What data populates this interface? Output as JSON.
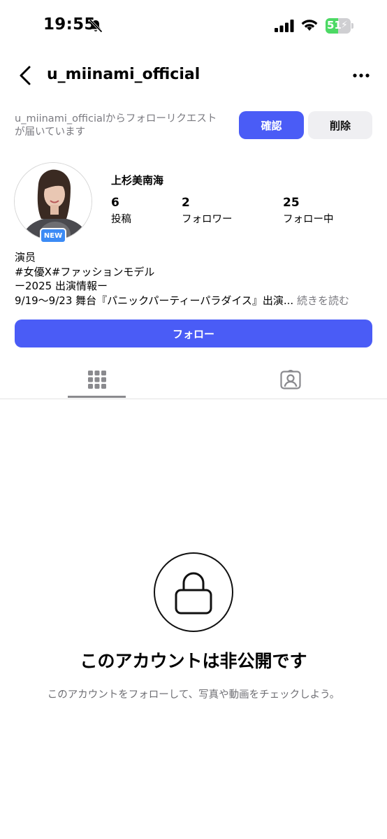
{
  "status_bar": {
    "time": "19:55",
    "battery_level": "51",
    "icons": [
      "bell-slash-icon",
      "signal-icon",
      "wifi-icon",
      "battery-charging-icon"
    ]
  },
  "header": {
    "title": "u_miinami_official",
    "back_icon": "chevron-left-icon",
    "more_icon": "more-horizontal-icon"
  },
  "follow_request": {
    "text": "u_miinami_officialからフォローリクエストが届いています",
    "confirm_label": "確認",
    "delete_label": "削除"
  },
  "profile": {
    "display_name": "上杉美南海",
    "badge": "NEW",
    "stats": [
      {
        "value": "6",
        "label": "投稿"
      },
      {
        "value": "2",
        "label": "フォロワー"
      },
      {
        "value": "25",
        "label": "フォロー中"
      }
    ],
    "bio": [
      "演员",
      "#女優X#ファッションモデル",
      "ー2025 出演情報ー",
      "9/19～9/23 舞台『パニックパーティーパラダイス』出演..."
    ],
    "read_more": "続きを読む"
  },
  "follow_button": "フォロー",
  "tabs": [
    {
      "icon": "grid-icon",
      "active": true
    },
    {
      "icon": "tagged-person-icon",
      "active": false
    }
  ],
  "private": {
    "icon": "lock-icon",
    "title": "このアカウントは非公開です",
    "subtitle": "このアカウントをフォローして、写真や動画をチェックしよう。"
  },
  "colors": {
    "accent": "#4a5cf6",
    "badge": "#3c8bf5",
    "secondary_button": "#efeff2",
    "muted_text": "#7a7a80",
    "battery_fill": "#4cd964"
  }
}
